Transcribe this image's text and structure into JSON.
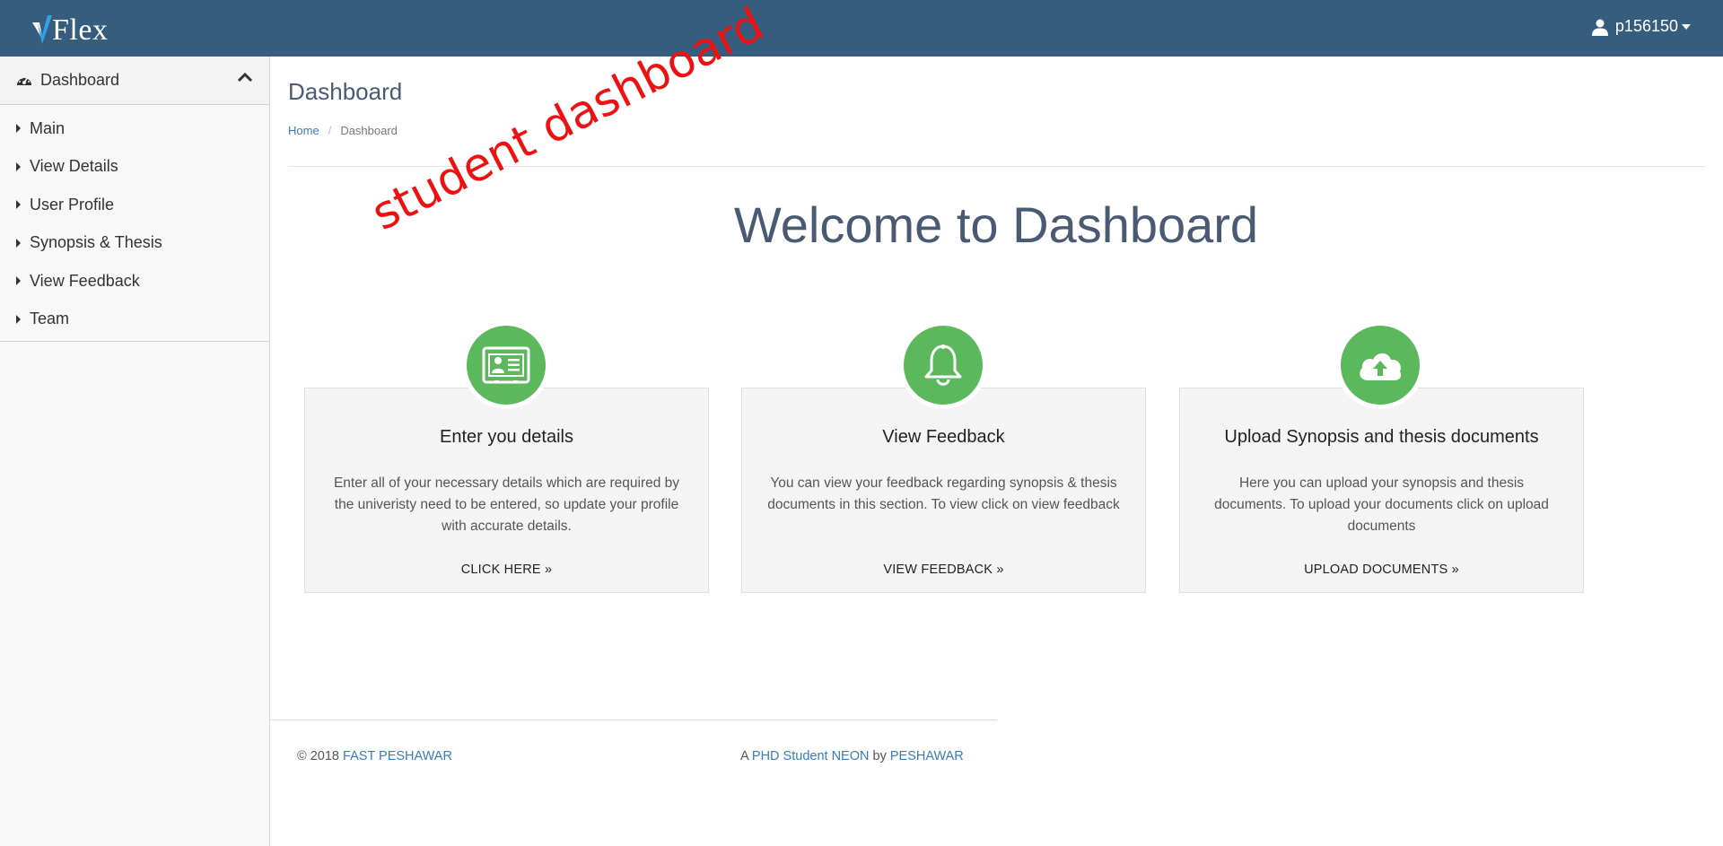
{
  "header": {
    "logo_text": "Flex",
    "username": "p156150"
  },
  "sidebar": {
    "section_label": "Dashboard",
    "items": [
      {
        "label": "Main"
      },
      {
        "label": "View Details"
      },
      {
        "label": "User Profile"
      },
      {
        "label": "Synopsis & Thesis"
      },
      {
        "label": "View Feedback"
      },
      {
        "label": "Team"
      }
    ]
  },
  "main": {
    "page_title": "Dashboard",
    "breadcrumb": {
      "home": "Home",
      "separator": "/",
      "current": "Dashboard"
    },
    "welcome": "Welcome to Dashboard",
    "annotation": "student dashboard",
    "cards": [
      {
        "icon": "id-card-icon",
        "title": "Enter you details",
        "description": "Enter all of your necessary details which are required by the univeristy need to be entered, so update your profile with accurate details.",
        "link": "CLICK HERE »"
      },
      {
        "icon": "bell-icon",
        "title": "View Feedback",
        "description": "You can view your feedback regarding synopsis & thesis documents in this section. To view click on view feedback",
        "link": "VIEW FEEDBACK »"
      },
      {
        "icon": "cloud-upload-icon",
        "title": "Upload Synopsis and thesis documents",
        "description": "Here you can upload your synopsis and thesis documents. To upload your documents click on upload documents",
        "link": "UPLOAD DOCUMENTS »"
      }
    ]
  },
  "footer": {
    "copyright": "© 2018",
    "org_link": "FAST PESHAWAR",
    "credit_prefix": "A",
    "credit_link": "PHD Student NEON",
    "credit_by": "by",
    "credit_place": "PESHAWAR"
  },
  "colors": {
    "topbar": "#365d7e",
    "accent_green": "#5cb85c",
    "link_blue": "#3a7bbf",
    "annotation_red": "#ee1111"
  }
}
